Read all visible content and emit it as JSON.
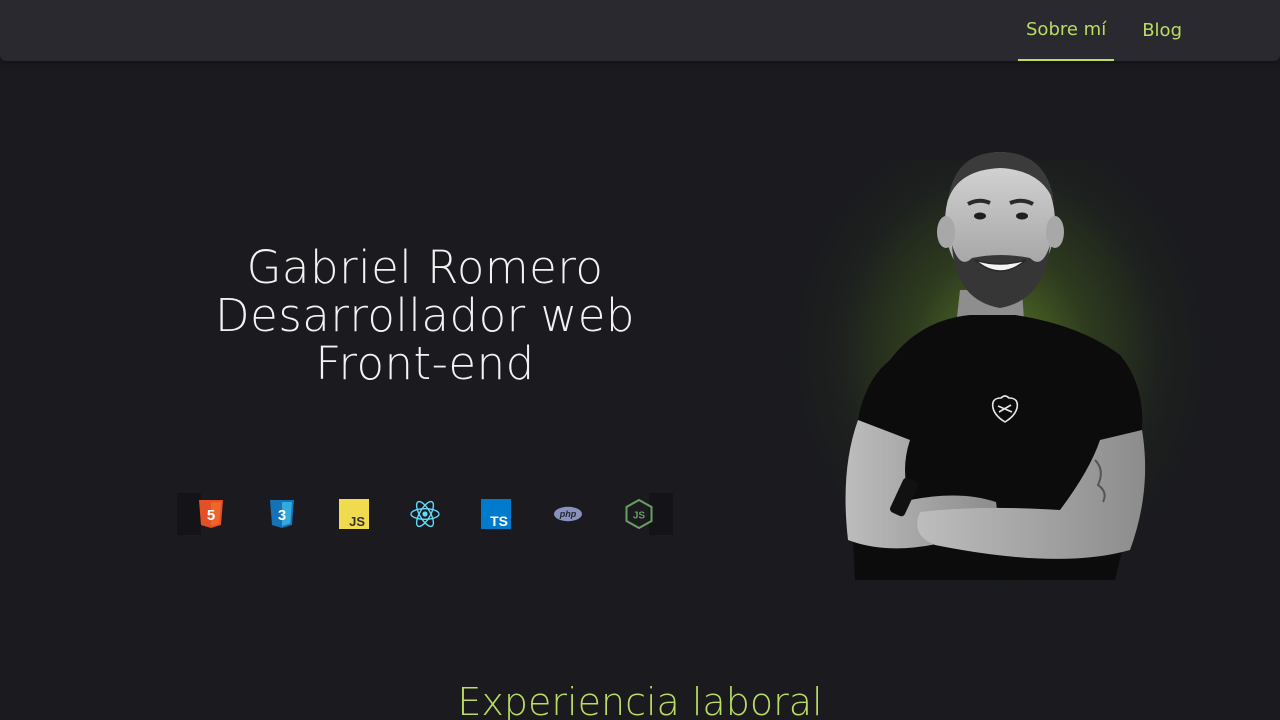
{
  "nav": {
    "items": [
      {
        "label": "Sobre mí",
        "active": true
      },
      {
        "label": "Blog",
        "active": false
      }
    ]
  },
  "hero": {
    "line1": "Gabriel Romero",
    "line2": "Desarrollador web",
    "line3": "Front-end"
  },
  "tech_icons": [
    {
      "icon": "html5-icon",
      "text": "5",
      "color": "#e34f26"
    },
    {
      "icon": "css3-icon",
      "text": "3",
      "color": "#1572b6"
    },
    {
      "icon": "javascript-icon",
      "text": "JS",
      "color": "#f0db4f"
    },
    {
      "icon": "react-icon",
      "color": "#61dafb"
    },
    {
      "icon": "typescript-icon",
      "text": "TS",
      "color": "#007acc"
    },
    {
      "icon": "php-icon",
      "text": "php",
      "color": "#8892be"
    },
    {
      "icon": "nodejs-icon",
      "text": "JS",
      "color": "#68a063"
    }
  ],
  "section": {
    "title": "Experiencia laboral"
  },
  "colors": {
    "accent": "#b9dd62",
    "background": "#1a1a1f",
    "topbar": "#2a2930"
  }
}
